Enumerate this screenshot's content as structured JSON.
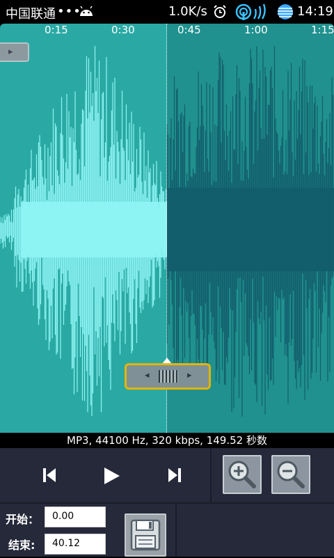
{
  "status_bar": {
    "carrier": "中国联通",
    "dots": "•••",
    "speed": "1.0K/s",
    "time": "14:19"
  },
  "waveform": {
    "ticks": [
      "0:15",
      "0:30",
      "0:45",
      "1:00",
      "1:15"
    ],
    "colors": {
      "background": "#2aa9a4",
      "selected_wave": "#8ff5f5",
      "unselected_wave": "#125d6b",
      "handle_border": "#e6b400"
    }
  },
  "file_info": "MP3, 44100 Hz, 320 kbps, 149.52 秒数",
  "controls": {
    "start_label": "开始：",
    "start_value": "0.00",
    "end_label": "结束:",
    "end_value": "40.12",
    "icons": [
      "skip-previous-icon",
      "play-icon",
      "skip-next-icon",
      "zoom-in-icon",
      "zoom-out-icon",
      "save-icon"
    ]
  }
}
